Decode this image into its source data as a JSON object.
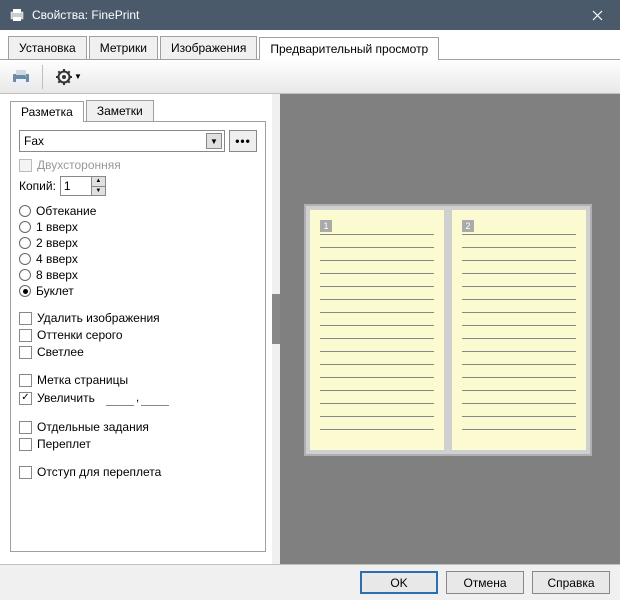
{
  "window": {
    "title": "Свойства: FinePrint"
  },
  "main_tabs": {
    "items": [
      "Установка",
      "Метрики",
      "Изображения",
      "Предварительный просмотр"
    ],
    "active": 3
  },
  "sub_tabs": {
    "items": [
      "Разметка",
      "Заметки"
    ],
    "active": 0
  },
  "layout_panel": {
    "combo_value": "Fax",
    "duplex": {
      "label": "Двухсторонняя",
      "checked": false,
      "disabled": true
    },
    "copies": {
      "label": "Копий:",
      "value": "1"
    },
    "layouts": [
      {
        "label": "Обтекание",
        "selected": false
      },
      {
        "label": "1 вверх",
        "selected": false
      },
      {
        "label": "2 вверх",
        "selected": false
      },
      {
        "label": "4 вверх",
        "selected": false
      },
      {
        "label": "8 вверх",
        "selected": false
      },
      {
        "label": "Буклет",
        "selected": true
      }
    ],
    "options1": [
      {
        "label": "Удалить изображения",
        "checked": false
      },
      {
        "label": "Оттенки серого",
        "checked": false
      },
      {
        "label": "Светлее",
        "checked": false
      }
    ],
    "page_mark": {
      "label": "Метка страницы",
      "checked": false
    },
    "enlarge": {
      "label": "Увеличить",
      "checked": true
    },
    "options2": [
      {
        "label": "Отдельные задания",
        "checked": false
      },
      {
        "label": "Переплет",
        "checked": false
      }
    ],
    "gutter": {
      "label": "Отступ для переплета",
      "checked": false
    }
  },
  "preview": {
    "page1": "1",
    "page2": "2"
  },
  "buttons": {
    "ok": "OK",
    "cancel": "Отмена",
    "help": "Справка"
  },
  "icons": {
    "dots": "•••"
  }
}
